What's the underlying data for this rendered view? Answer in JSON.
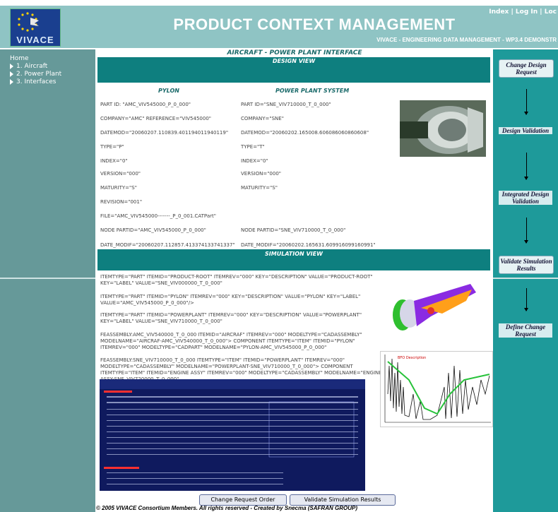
{
  "header": {
    "logo_text": "VIVACE",
    "title": "PRODUCT CONTEXT MANAGEMENT",
    "subtitle": "VIVACE - ENGINEERING DATA MANAGEMENT - WP3.4 DEMONSTR",
    "nav": {
      "index": "Index",
      "sep1": " | ",
      "login": "Log In",
      "sep2": " | ",
      "logout": "Loc"
    }
  },
  "sidebar": {
    "home": "Home",
    "items": [
      {
        "label": "1. Aircraft"
      },
      {
        "label": "2. Power Plant"
      },
      {
        "label": "3. Interfaces"
      }
    ]
  },
  "main": {
    "breadcrumb": "AIRCRAFT - POWER PLANT INTERFACE",
    "design_view": "DESIGN VIEW",
    "simulation_view": "SIMULATION VIEW",
    "pylon": {
      "heading": "PYLON",
      "part_id": "PART ID: \"AMC_VIV545000_P_0_000\"",
      "company": "COMPANY=\"AMC\" REFERENCE=\"VIV545000\"",
      "datemod": "DATEMOD=\"20060207.110839.401194011940119\"",
      "type": "TYPE=\"P\"",
      "index": "INDEX=\"0\"",
      "version": "VERSION=\"000\"",
      "maturity": "MATURITY=\"S\"",
      "revision": "REVISION=\"001\"",
      "file": "FILE=\"AMC_VIV545000-------_P_0_001.CATPart\"",
      "node_partid": "NODE PARTID=\"AMC_VIV545000_P_0_000\"",
      "date_modif": "DATE_MODIF=\"20060207.112857.413374133741337\""
    },
    "powerplant": {
      "heading": "POWER PLANT SYSTEM",
      "part_id": "PART ID=\"SNE_VIV710000_T_0_000\"",
      "company": "COMPANY=\"SNE\"",
      "datemod": "DATEMOD=\"20060202.165008.606086060860608\"",
      "type": "TYPE=\"T\"",
      "index": "INDEX=\"0\"",
      "version": "VERSION=\"000\"",
      "maturity": "MATURITY=\"S\"",
      "node_partid": "NODE PARTID=\"SNE_VIV710000_T_0_000\"",
      "date_modif": "DATE_MODIF=\"20060202.165631.609916099160991\""
    },
    "simulation": {
      "line1": "ITEMTYPE=\"PART\" ITEMID=\"PRODUCT-ROOT\" ITEMREV=\"000\" KEY=\"DESCRIPTION\" VALUE=\"PRODUCT-ROOT\" KEY=\"LABEL\" VALUE=\"SNE_VIV000000_T_0_000\"",
      "line2": "ITEMTYPE=\"PART\" ITEMID=\"PYLON\" ITEMREV=\"000\" KEY=\"DESCRIPTION\" VALUE=\"PYLON\" KEY=\"LABEL\" VALUE=\"AMC_VIV545000_P_0_000\"/>",
      "line3": "ITEMTYPE=\"PART\" ITEMID=\"POWERPLANT\" ITEMREV=\"000\" KEY=\"DESCRIPTION\" VALUE=\"POWERPLANT\" KEY=\"LABEL\" VALUE=\"SNE_VIV710000_T_0_000\"",
      "line4": "FEASSEMBLY:AMC_VIV540000_T_0_000 ITEMID=\"AIRCRAF\" ITEMREV=\"000\" MODELTYPE=\"CADASSEMBLY\" MODELNAME=\"AIRCRAF-AMC_VIV540000_T_0_000\"> COMPONENT ITEMTYPE=\"ITEM\" ITEMID=\"PYLON\" ITEMREV=\"000\" MODELTYPE=\"CADPART\" MODELNAME=\"PYLON-AMC_VIV545000_P_0_000\"",
      "line5": "FEASSEMBLY:SNE_VIV710000_T_0_000 ITEMTYPE=\"ITEM\" ITEMID=\"POWERPLANT\" ITEMREV=\"000\" MODELTYPE=\"CADASSEMBLY\" MODELNAME=\"POWERPLANT-SNE_VIV710000_T_0_000\"> COMPONENT ITEMTYPE=\"ITEM\" ITEMID=\"ENGINE ASSY\" ITEMREV=\"000\" MODELTYPE=\"CADASSEMBLY\" MODELNAME=\"ENGINE ASSY-SNE_VIV720000_T_0_000\""
    },
    "plot_label": "BFO Description"
  },
  "process": {
    "change_design_request": "Change Design Request",
    "design_validation": "Design Validation",
    "integrated_design_validation": "Integrated Design Validation",
    "validate_simulation_results": "Validate Simulation Results",
    "define_change_request": "Define Change Request"
  },
  "buttons": {
    "change_request_order": "Change Request Order",
    "validate_simulation_results": "Validate Simulation Results"
  },
  "footer": "© 2005 VIVACE Consortium Members. All rights reserved - Created by Snecma (SAFRAN GROUP)",
  "colors": {
    "header": "#8fc4c4",
    "sidebar": "#669999",
    "bar": "#0e7f7f",
    "process": "#1e9a9a"
  }
}
